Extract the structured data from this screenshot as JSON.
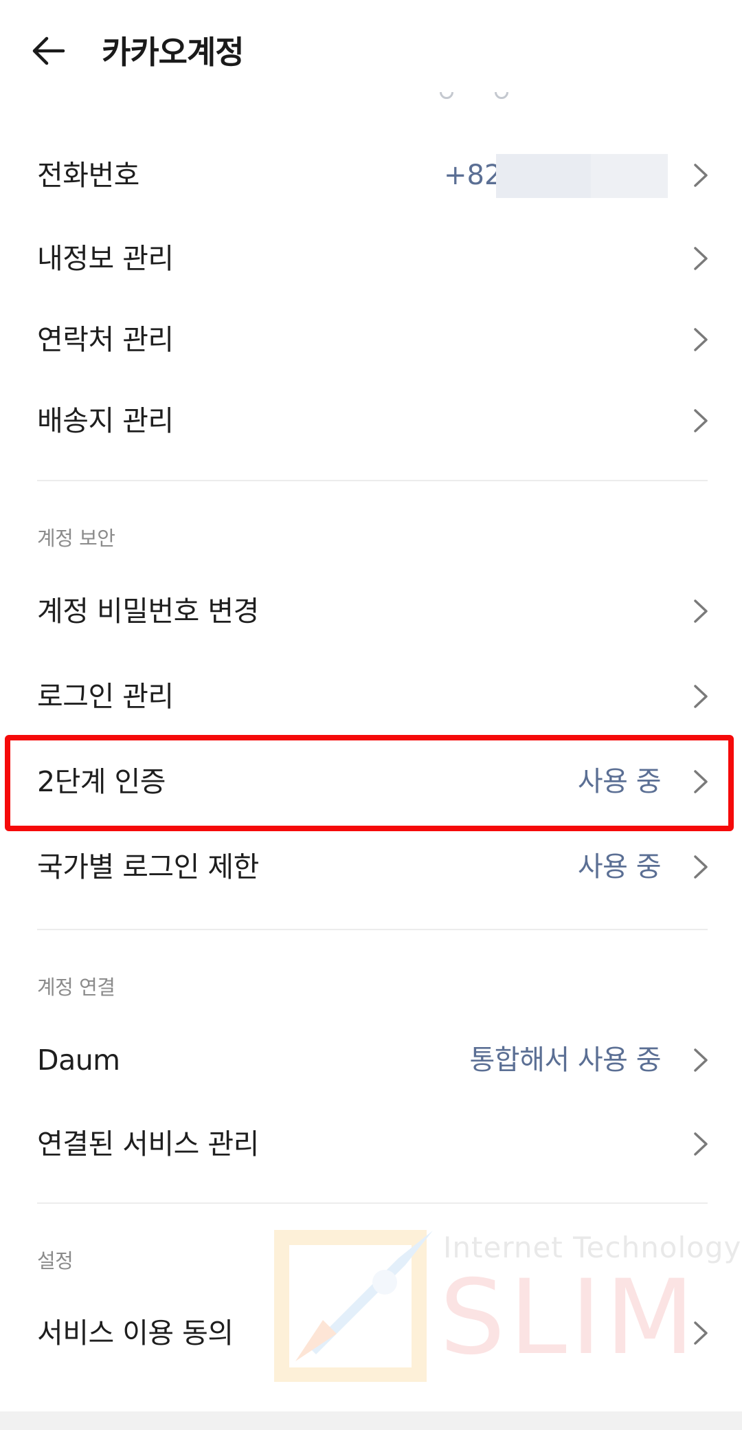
{
  "header": {
    "title": "카카오계정",
    "back_icon": "arrow-left-icon"
  },
  "account": {
    "phone": {
      "label": "전화번호",
      "value": "+82"
    },
    "profile": {
      "label": "내정보 관리"
    },
    "contacts": {
      "label": "연락처 관리"
    },
    "shipping": {
      "label": "배송지 관리"
    }
  },
  "security": {
    "title": "계정 보안",
    "password": {
      "label": "계정 비밀번호 변경"
    },
    "login": {
      "label": "로그인 관리"
    },
    "two_factor": {
      "label": "2단계 인증",
      "value": "사용 중"
    },
    "country_restriction": {
      "label": "국가별 로그인 제한",
      "value": "사용 중"
    }
  },
  "linking": {
    "title": "계정 연결",
    "daum": {
      "label": "Daum",
      "value": "통합해서 사용 중"
    },
    "services": {
      "label": "연결된 서비스 관리"
    }
  },
  "settings": {
    "title": "설정",
    "consent": {
      "label": "서비스 이용 동의"
    }
  },
  "watermark": {
    "small": "Internet Technology",
    "big": "SLIM"
  },
  "colors": {
    "value_text": "#5b6f94",
    "highlight": "#f50a0a",
    "chevron": "#7a7a7a"
  }
}
